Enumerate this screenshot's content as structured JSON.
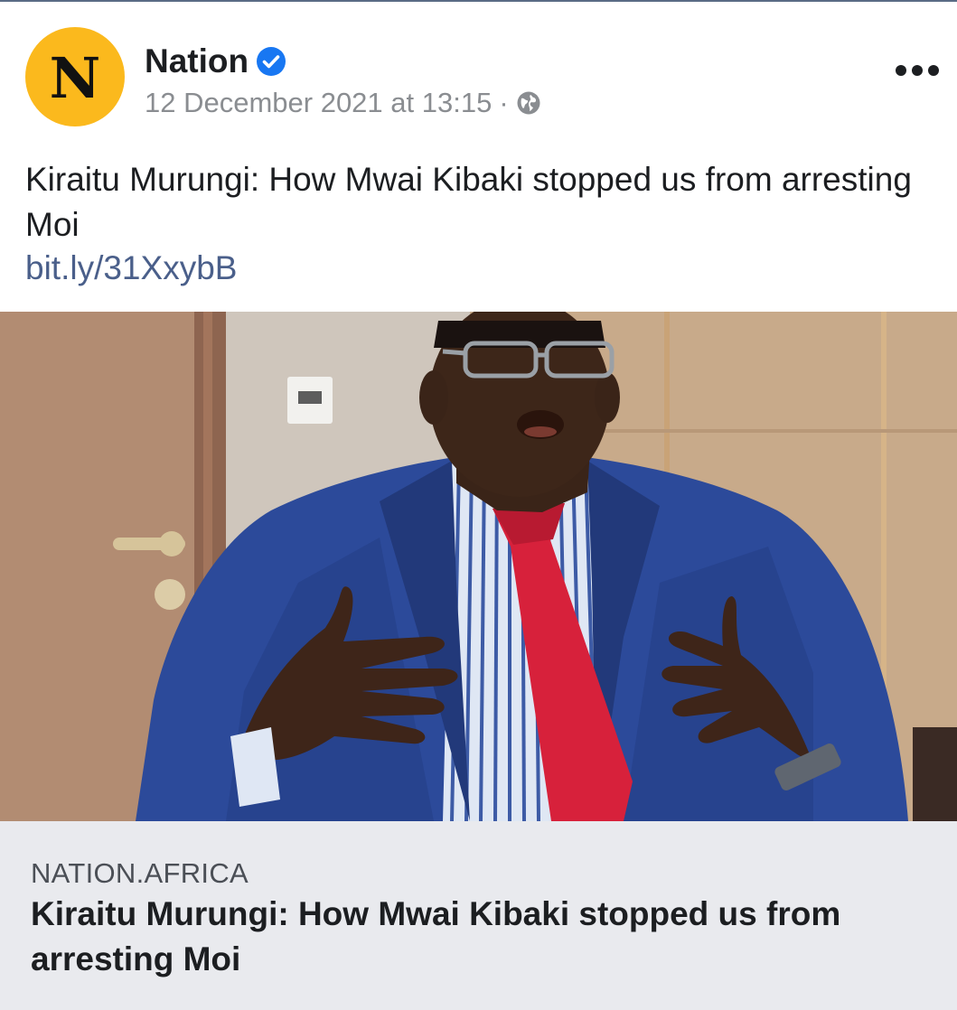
{
  "post": {
    "page_name": "Nation",
    "avatar_letter": "N",
    "verified": true,
    "timestamp": "12 December 2021 at 13:15",
    "separator": "·",
    "privacy_icon": "globe-icon",
    "more_icon": "more-options-icon",
    "text": "Kiraitu Murungi: How Mwai Kibaki stopped us from arresting Moi",
    "link": "bit.ly/31XxybB"
  },
  "preview": {
    "domain": "NATION.AFRICA",
    "title": "Kiraitu Murungi: How Mwai Kibaki stopped us from arresting Moi"
  },
  "colors": {
    "avatar_bg": "#fbb91d",
    "verified_blue": "#1877f2",
    "link_color": "#4a5f8a",
    "preview_bg": "#e9eaee",
    "meta_gray": "#8a8d91"
  }
}
